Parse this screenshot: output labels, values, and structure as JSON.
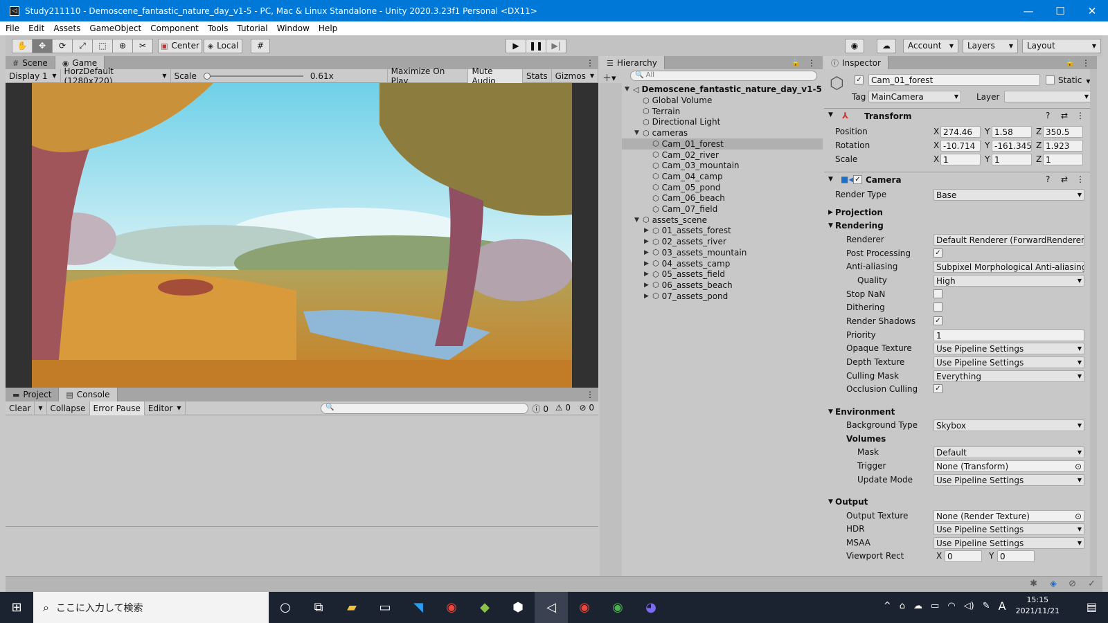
{
  "window": {
    "title": "Study211110 - Demoscene_fantastic_nature_day_v1-5 - PC, Mac & Linux Standalone - Unity 2020.3.23f1 Personal <DX11>",
    "controls": [
      "—",
      "☐",
      "✕"
    ]
  },
  "menu": [
    "File",
    "Edit",
    "Assets",
    "GameObject",
    "Component",
    "Tools",
    "Tutorial",
    "Window",
    "Help"
  ],
  "toolbar": {
    "tools": [
      "hand-icon",
      "move-icon",
      "rotate-icon",
      "scale-icon",
      "rect-icon",
      "transform-icon",
      "custom-tool-icon"
    ],
    "center": "Center",
    "local": "Local",
    "account": "Account",
    "layers": "Layers",
    "layout": "Layout"
  },
  "scene_tabs": {
    "scene": "Scene",
    "game": "Game"
  },
  "game_bar": {
    "display": "Display 1",
    "resolution": "HorzDefault (1280x720)",
    "scale_label": "Scale",
    "scale_value": "0.61x",
    "maximize": "Maximize On Play",
    "mute": "Mute Audio",
    "stats": "Stats",
    "gizmos": "Gizmos"
  },
  "console": {
    "tabs": {
      "project": "Project",
      "console": "Console"
    },
    "clear": "Clear",
    "collapse": "Collapse",
    "error_pause": "Error Pause",
    "editor": "Editor",
    "info_count": "0",
    "warn_count": "0",
    "error_count": "0"
  },
  "hierarchy": {
    "tab": "Hierarchy",
    "search_placeholder": "All",
    "scene": "Demoscene_fantastic_nature_day_v1-5",
    "items": [
      {
        "label": "Global Volume",
        "depth": 1,
        "expander": ""
      },
      {
        "label": "Terrain",
        "depth": 1,
        "expander": ""
      },
      {
        "label": "Directional Light",
        "depth": 1,
        "expander": ""
      },
      {
        "label": "cameras",
        "depth": 1,
        "expander": "open"
      },
      {
        "label": "Cam_01_forest",
        "depth": 2,
        "expander": "",
        "selected": true
      },
      {
        "label": "Cam_02_river",
        "depth": 2,
        "expander": ""
      },
      {
        "label": "Cam_03_mountain",
        "depth": 2,
        "expander": ""
      },
      {
        "label": "Cam_04_camp",
        "depth": 2,
        "expander": ""
      },
      {
        "label": "Cam_05_pond",
        "depth": 2,
        "expander": ""
      },
      {
        "label": "Cam_06_beach",
        "depth": 2,
        "expander": ""
      },
      {
        "label": "Cam_07_field",
        "depth": 2,
        "expander": ""
      },
      {
        "label": "assets_scene",
        "depth": 1,
        "expander": "open"
      },
      {
        "label": "01_assets_forest",
        "depth": 2,
        "expander": "closed"
      },
      {
        "label": "02_assets_river",
        "depth": 2,
        "expander": "closed"
      },
      {
        "label": "03_assets_mountain",
        "depth": 2,
        "expander": "closed"
      },
      {
        "label": "04_assets_camp",
        "depth": 2,
        "expander": "closed"
      },
      {
        "label": "05_assets_field",
        "depth": 2,
        "expander": "closed"
      },
      {
        "label": "06_assets_beach",
        "depth": 2,
        "expander": "closed"
      },
      {
        "label": "07_assets_pond",
        "depth": 2,
        "expander": "closed"
      }
    ]
  },
  "inspector": {
    "tab": "Inspector",
    "object_name": "Cam_01_forest",
    "static": "Static",
    "tag_label": "Tag",
    "tag_value": "MainCamera",
    "layer_label": "Layer",
    "layer_value": "",
    "transform": {
      "title": "Transform",
      "position": {
        "label": "Position",
        "x": "274.46",
        "y": "1.58",
        "z": "350.5"
      },
      "rotation": {
        "label": "Rotation",
        "x": "-10.714",
        "y": "-161.345",
        "z": "1.923"
      },
      "scale": {
        "label": "Scale",
        "x": "1",
        "y": "1",
        "z": "1"
      }
    },
    "camera": {
      "title": "Camera",
      "render_type_label": "Render Type",
      "render_type": "Base",
      "projection": "Projection",
      "rendering": "Rendering",
      "renderer_label": "Renderer",
      "renderer": "Default Renderer (ForwardRenderer)",
      "post_processing": "Post Processing",
      "anti_aliasing_label": "Anti-aliasing",
      "anti_aliasing": "Subpixel Morphological Anti-aliasing",
      "quality_label": "Quality",
      "quality": "High",
      "stop_nan": "Stop NaN",
      "dithering": "Dithering",
      "render_shadows": "Render Shadows",
      "priority_label": "Priority",
      "priority": "1",
      "opaque_texture_label": "Opaque Texture",
      "opaque_texture": "Use Pipeline Settings",
      "depth_texture_label": "Depth Texture",
      "depth_texture": "Use Pipeline Settings",
      "culling_mask_label": "Culling Mask",
      "culling_mask": "Everything",
      "occlusion_culling": "Occlusion Culling",
      "environment": "Environment",
      "background_type_label": "Background Type",
      "background_type": "Skybox",
      "volumes": "Volumes",
      "mask_label": "Mask",
      "mask": "Default",
      "trigger_label": "Trigger",
      "trigger": "None (Transform)",
      "update_mode_label": "Update Mode",
      "update_mode": "Use Pipeline Settings",
      "output": "Output",
      "output_texture_label": "Output Texture",
      "output_texture": "None (Render Texture)",
      "hdr_label": "HDR",
      "hdr": "Use Pipeline Settings",
      "msaa_label": "MSAA",
      "msaa": "Use Pipeline Settings",
      "viewport_label": "Viewport Rect",
      "viewport_x": "0",
      "viewport_y": "0"
    }
  },
  "taskbar": {
    "search_placeholder": "ここに入力して検索",
    "time": "15:15",
    "date": "2021/11/21",
    "ime": "A"
  }
}
